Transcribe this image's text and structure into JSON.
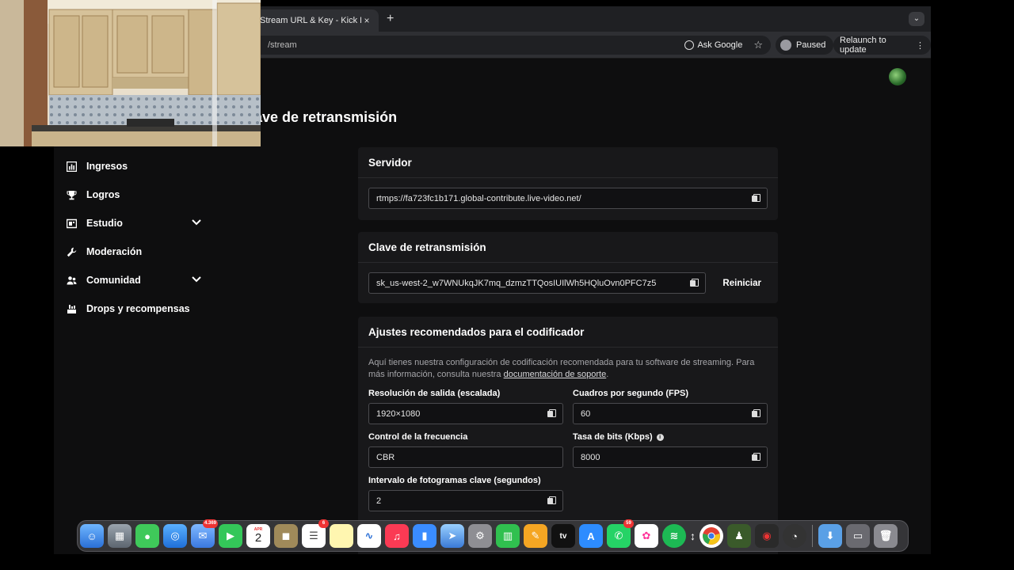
{
  "browser": {
    "tab_title": "Stream URL & Key - Kick Dash",
    "tab_close": "×",
    "new_tab": "+",
    "url": "/stream",
    "ask_google": "Ask Google",
    "profile_status": "Paused",
    "relaunch": "Relaunch to update"
  },
  "page": {
    "title": "or y clave de retransmisión"
  },
  "sidebar": {
    "items": [
      {
        "label": "Ingresos",
        "icon": "chart-icon"
      },
      {
        "label": "Logros",
        "icon": "trophy-icon"
      },
      {
        "label": "Estudio",
        "icon": "studio-icon",
        "expandable": true
      },
      {
        "label": "Moderación",
        "icon": "wrench-icon"
      },
      {
        "label": "Comunidad",
        "icon": "people-icon",
        "expandable": true
      },
      {
        "label": "Drops y recompensas",
        "icon": "drops-icon"
      }
    ]
  },
  "server": {
    "heading": "Servidor",
    "url": "rtmps://fa723fc1b171.global-contribute.live-video.net/"
  },
  "stream_key": {
    "heading": "Clave de retransmisión",
    "value": "sk_us-west-2_w7WNUkqJK7mq_dzmzTTQosIUIlWh5HQluOvn0PFC7z5",
    "reset_label": "Reiniciar"
  },
  "encoder": {
    "heading": "Ajustes recomendados para el codificador",
    "desc_prefix": "Aquí tienes nuestra configuración de codificación recomendada para tu software de streaming. Para más información, consulta nuestra ",
    "desc_link": "documentación de soporte",
    "desc_suffix": ".",
    "resolution_label": "Resolución de salida (escalada)",
    "resolution_value": "1920×1080",
    "fps_label": "Cuadros por segundo (FPS)",
    "fps_value": "60",
    "rate_control_label": "Control de la frecuencia",
    "rate_control_value": "CBR",
    "bitrate_label": "Tasa de bits (Kbps)",
    "bitrate_value": "8000",
    "keyframe_label": "Intervalo de fotogramas clave (segundos)",
    "keyframe_value": "2"
  },
  "dock": {
    "mail_badge": "4.369",
    "calendar_month": "APR",
    "calendar_day": "2",
    "reminders_badge": "6",
    "tv_label": "tv",
    "whatsapp_badge": "59"
  }
}
